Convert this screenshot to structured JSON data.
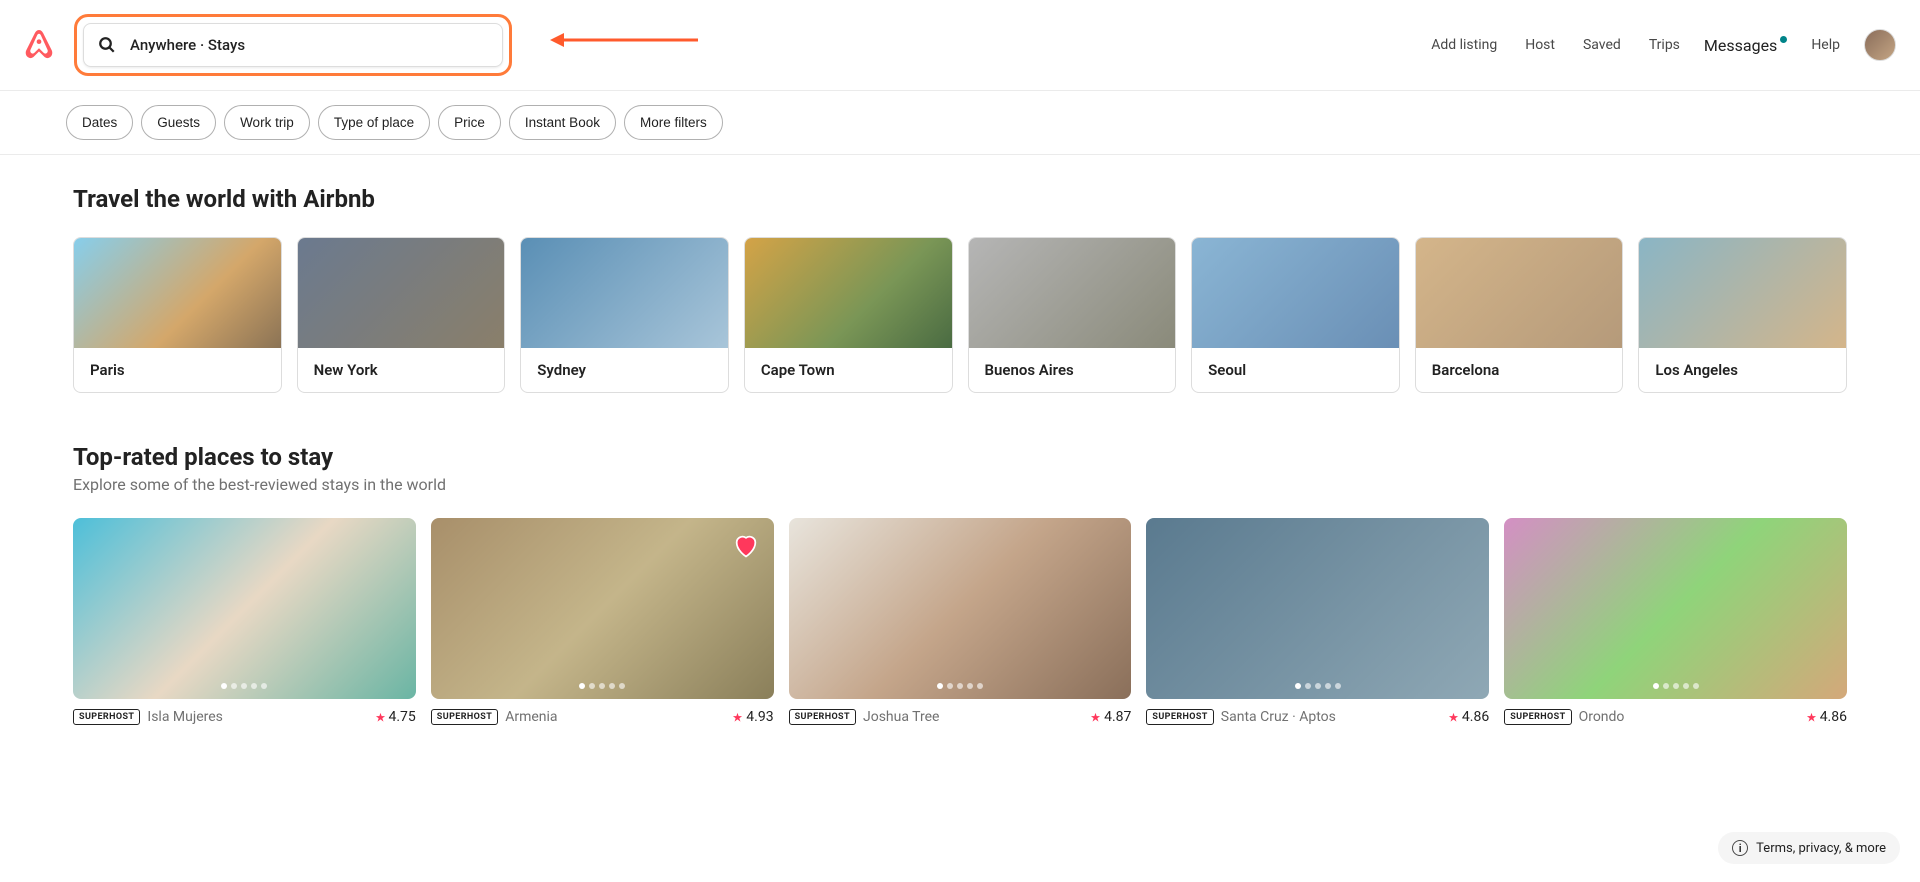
{
  "search": {
    "text": "Anywhere · Stays"
  },
  "nav": {
    "add_listing": "Add listing",
    "host": "Host",
    "saved": "Saved",
    "trips": "Trips",
    "messages": "Messages",
    "help": "Help"
  },
  "filters": [
    "Dates",
    "Guests",
    "Work trip",
    "Type of place",
    "Price",
    "Instant Book",
    "More filters"
  ],
  "cities_section": {
    "title": "Travel the world with Airbnb",
    "cities": [
      "Paris",
      "New York",
      "Sydney",
      "Cape Town",
      "Buenos Aires",
      "Seoul",
      "Barcelona",
      "Los Angeles"
    ]
  },
  "listings_section": {
    "title": "Top-rated places to stay",
    "subtitle": "Explore some of the best-reviewed stays in the world",
    "listings": [
      {
        "badge": "SUPERHOST",
        "location": "Isla Mujeres",
        "rating": "4.75",
        "favorited": false
      },
      {
        "badge": "SUPERHOST",
        "location": "Armenia",
        "rating": "4.93",
        "favorited": true
      },
      {
        "badge": "SUPERHOST",
        "location": "Joshua Tree",
        "rating": "4.87",
        "favorited": false
      },
      {
        "badge": "SUPERHOST",
        "location": "Santa Cruz · Aptos",
        "rating": "4.86",
        "favorited": false
      },
      {
        "badge": "SUPERHOST",
        "location": "Orondo",
        "rating": "4.86",
        "favorited": false
      }
    ]
  },
  "terms_label": "Terms, privacy, & more"
}
